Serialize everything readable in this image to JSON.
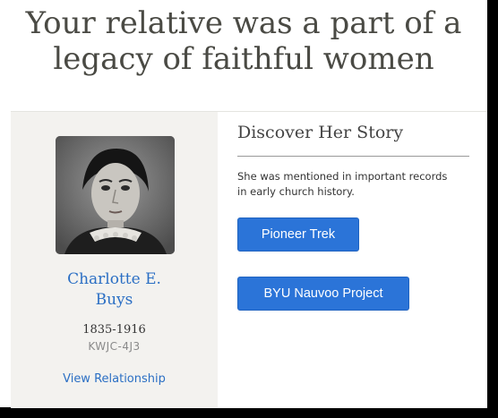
{
  "headline": {
    "line1": "Your relative was a part of a",
    "line2": "legacy of faithful women"
  },
  "profile": {
    "portrait_alt": "portrait photo",
    "name_line1": "Charlotte E.",
    "name_line2": "Buys",
    "lifespan": "1835-1916",
    "person_id": "KWJC-4J3",
    "view_relationship": "View Relationship"
  },
  "story": {
    "title": "Discover Her Story",
    "description": "She was mentioned in important records in early church history.",
    "buttons": {
      "pioneer_trek": "Pioneer Trek",
      "byu_nauvoo": "BYU Nauvoo Project"
    }
  },
  "colors": {
    "link": "#2b6fc4",
    "button": "#2b74d8",
    "profile_panel": "#f3f2ef",
    "headline": "#4a4a44",
    "background_frame": "#000000"
  }
}
